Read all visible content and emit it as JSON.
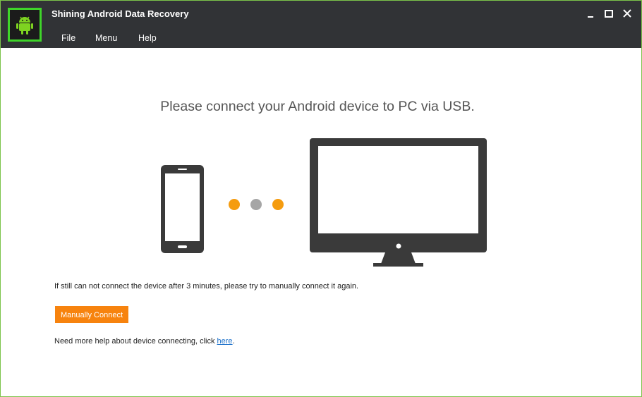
{
  "window": {
    "title": "Shining Android Data Recovery",
    "menu": [
      {
        "label": "File"
      },
      {
        "label": "Menu"
      },
      {
        "label": "Help"
      }
    ],
    "controls": [
      "minimize-icon",
      "maximize-icon",
      "close-icon"
    ]
  },
  "main": {
    "headline": "Please connect your Android device to PC via USB.",
    "instruction": "If still can not connect the device after 3 minutes, please try to manually connect it again.",
    "manual_connect_label": "Manually Connect",
    "help_prefix": "Need more help about device connecting, click ",
    "help_link": "here",
    "help_suffix": "."
  },
  "colors": {
    "titlebar": "#313336",
    "accent_green": "#3fd52a",
    "button_orange": "#f7830e",
    "dot_orange": "#f59c0f",
    "dot_gray": "#a6a6a6",
    "device_dark": "#3a3a3a",
    "link_blue": "#1a6fc9"
  },
  "icons": {
    "logo": "android-robot-icon",
    "phone": "smartphone-icon",
    "computer": "monitor-icon"
  }
}
